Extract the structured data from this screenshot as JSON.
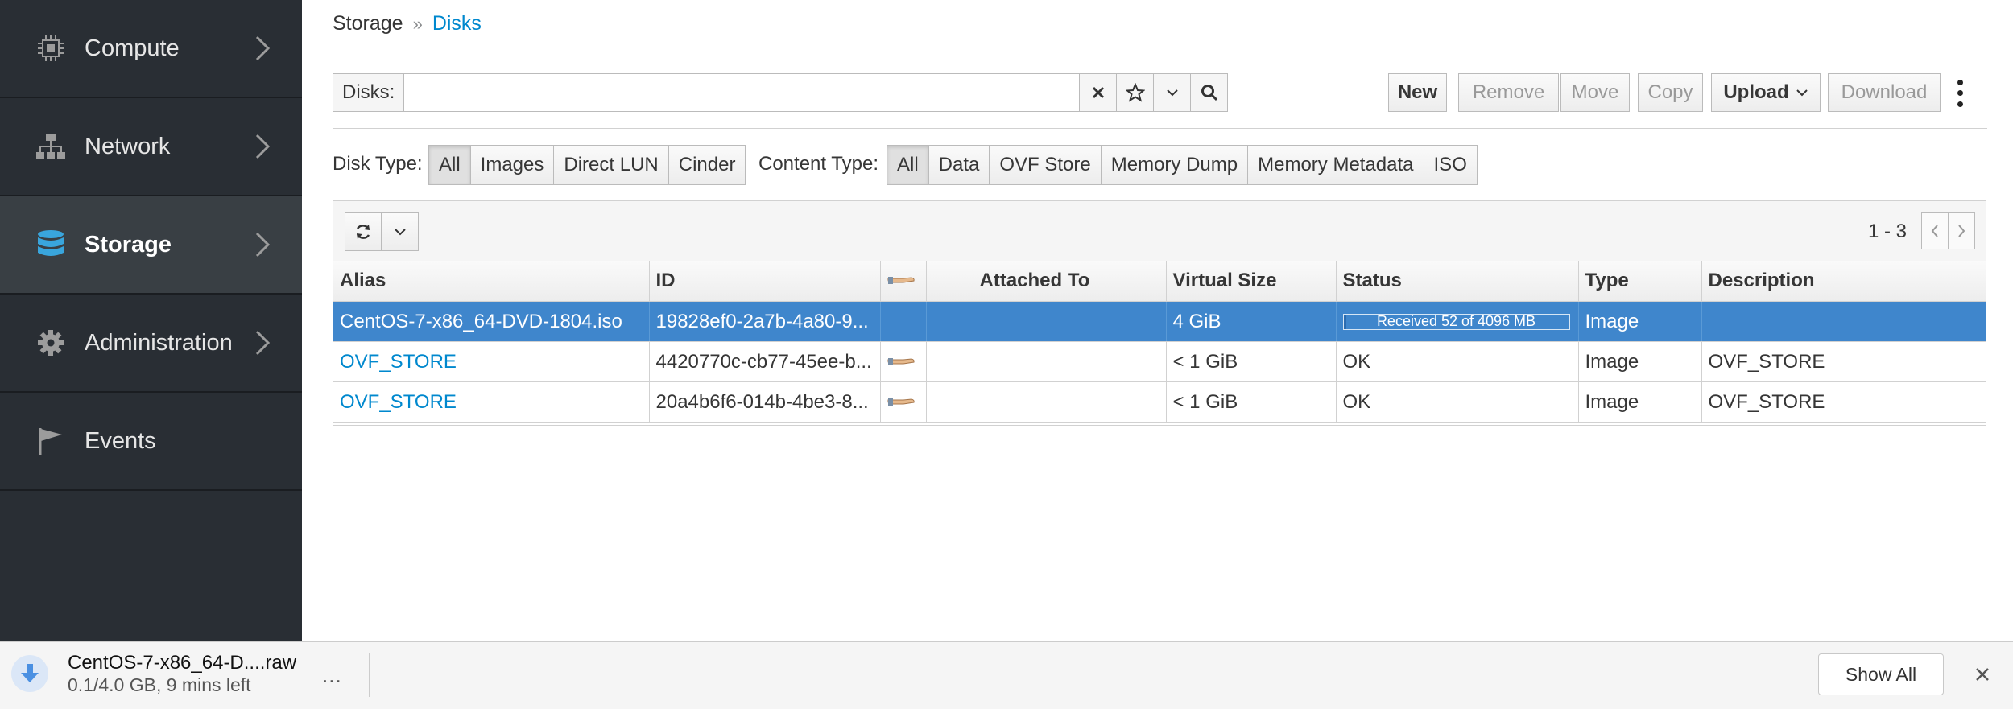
{
  "sidebar": {
    "items": [
      {
        "label": "Compute",
        "icon": "cpu-icon"
      },
      {
        "label": "Network",
        "icon": "network-icon"
      },
      {
        "label": "Storage",
        "icon": "database-icon",
        "active": true
      },
      {
        "label": "Administration",
        "icon": "gear-icon"
      },
      {
        "label": "Events",
        "icon": "flag-icon"
      }
    ]
  },
  "breadcrumb": {
    "parent": "Storage",
    "separator": "»",
    "current": "Disks"
  },
  "search": {
    "label": "Disks:",
    "value": ""
  },
  "toolbar": {
    "new": "New",
    "remove": "Remove",
    "move": "Move",
    "copy": "Copy",
    "upload": "Upload",
    "download": "Download"
  },
  "filters": {
    "disk_type_label": "Disk Type:",
    "disk_type_options": [
      "All",
      "Images",
      "Direct LUN",
      "Cinder"
    ],
    "content_type_label": "Content Type:",
    "content_type_options": [
      "All",
      "Data",
      "OVF Store",
      "Memory Dump",
      "Memory Metadata",
      "ISO"
    ]
  },
  "pager": {
    "range": "1 - 3"
  },
  "table": {
    "headers": [
      "Alias",
      "ID",
      "",
      "",
      "Attached To",
      "Virtual Size",
      "Status",
      "Type",
      "Description",
      ""
    ],
    "rows": [
      {
        "alias": "CentOS-7-x86_64-DVD-1804.iso",
        "id": "19828ef0-2a7b-4a80-9...",
        "attached_to": "",
        "virtual_size": "4 GiB",
        "status": "Received 52 of 4096 MB",
        "progress": 0.0127,
        "type": "Image",
        "description": "",
        "selected": true
      },
      {
        "alias": "OVF_STORE",
        "id": "4420770c-cb77-45ee-b...",
        "attached_to": "",
        "virtual_size": "< 1 GiB",
        "status": "OK",
        "type": "Image",
        "description": "OVF_STORE"
      },
      {
        "alias": "OVF_STORE",
        "id": "20a4b6f6-014b-4be3-8...",
        "attached_to": "",
        "virtual_size": "< 1 GiB",
        "status": "OK",
        "type": "Image",
        "description": "OVF_STORE"
      }
    ]
  },
  "download_bar": {
    "file_name": "CentOS-7-x86_64-D....raw",
    "status": "0.1/4.0 GB, 9 mins left",
    "more": "...",
    "show_all": "Show All"
  },
  "colors": {
    "sidebar_bg": "#292e34",
    "accent": "#0088ce",
    "selected_row": "#3f86cc"
  }
}
